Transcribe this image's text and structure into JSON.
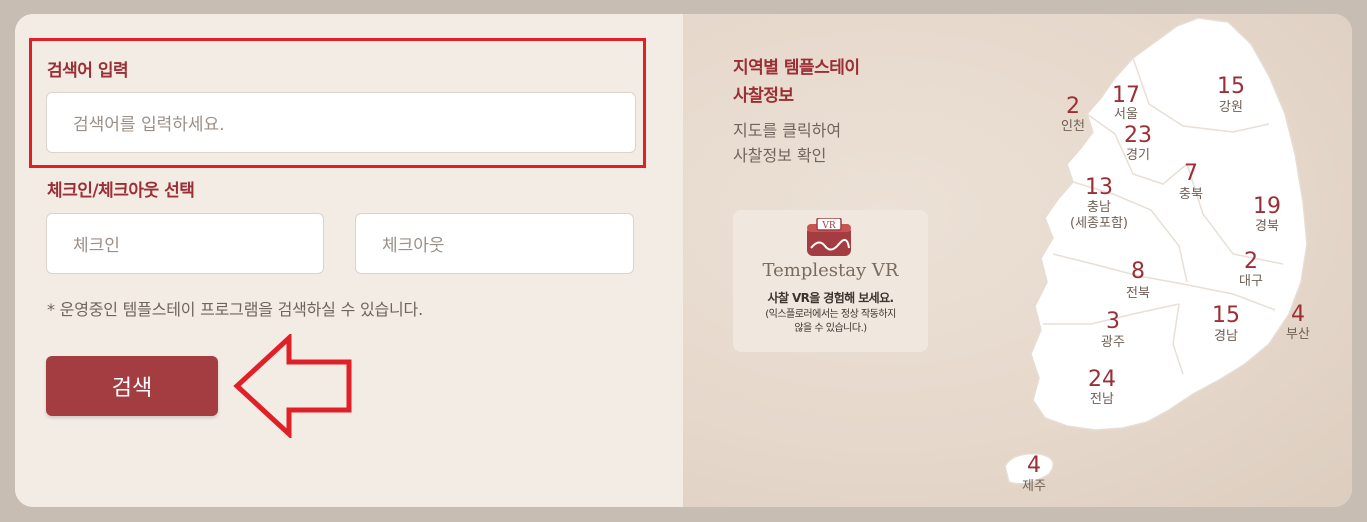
{
  "search": {
    "keyword_label": "검색어 입력",
    "keyword_placeholder": "검색어를 입력하세요.",
    "date_label": "체크인/체크아웃 선택",
    "checkin_placeholder": "체크인",
    "checkout_placeholder": "체크아웃",
    "note": "* 운영중인 템플스테이 프로그램을 검색하실 수 있습니다.",
    "button_label": "검색"
  },
  "info": {
    "title_line1": "지역별 템플스테이",
    "title_line2": "사찰정보",
    "desc_line1": "지도를 클릭하여",
    "desc_line2": "사찰정보 확인"
  },
  "vr": {
    "badge": "VR",
    "title": "Templestay VR",
    "subtitle": "사찰 VR을 경험해 보세요.",
    "note_line1": "(익스플로러에서는 정상 작동하지",
    "note_line2": "않을 수 있습니다.)"
  },
  "map": {
    "regions": [
      {
        "id": "incheon",
        "count": "2",
        "name": "인천"
      },
      {
        "id": "seoul",
        "count": "17",
        "name": "서울"
      },
      {
        "id": "gangwon",
        "count": "15",
        "name": "강원"
      },
      {
        "id": "gyeonggi",
        "count": "23",
        "name": "경기"
      },
      {
        "id": "chungbuk",
        "count": "7",
        "name": "충북"
      },
      {
        "id": "chungnam",
        "count": "13",
        "name": "충남",
        "extra": "(세종포함)"
      },
      {
        "id": "gyeongbuk",
        "count": "19",
        "name": "경북"
      },
      {
        "id": "daegu",
        "count": "2",
        "name": "대구"
      },
      {
        "id": "jeonbuk",
        "count": "8",
        "name": "전북"
      },
      {
        "id": "gwangju",
        "count": "3",
        "name": "광주"
      },
      {
        "id": "gyeongnam",
        "count": "15",
        "name": "경남"
      },
      {
        "id": "busan",
        "count": "4",
        "name": "부산"
      },
      {
        "id": "jeonnam",
        "count": "24",
        "name": "전남"
      },
      {
        "id": "jeju",
        "count": "4",
        "name": "제주"
      }
    ]
  },
  "colors": {
    "accent": "#9b2f35",
    "button": "#a43d42",
    "highlight": "#e01f26"
  }
}
